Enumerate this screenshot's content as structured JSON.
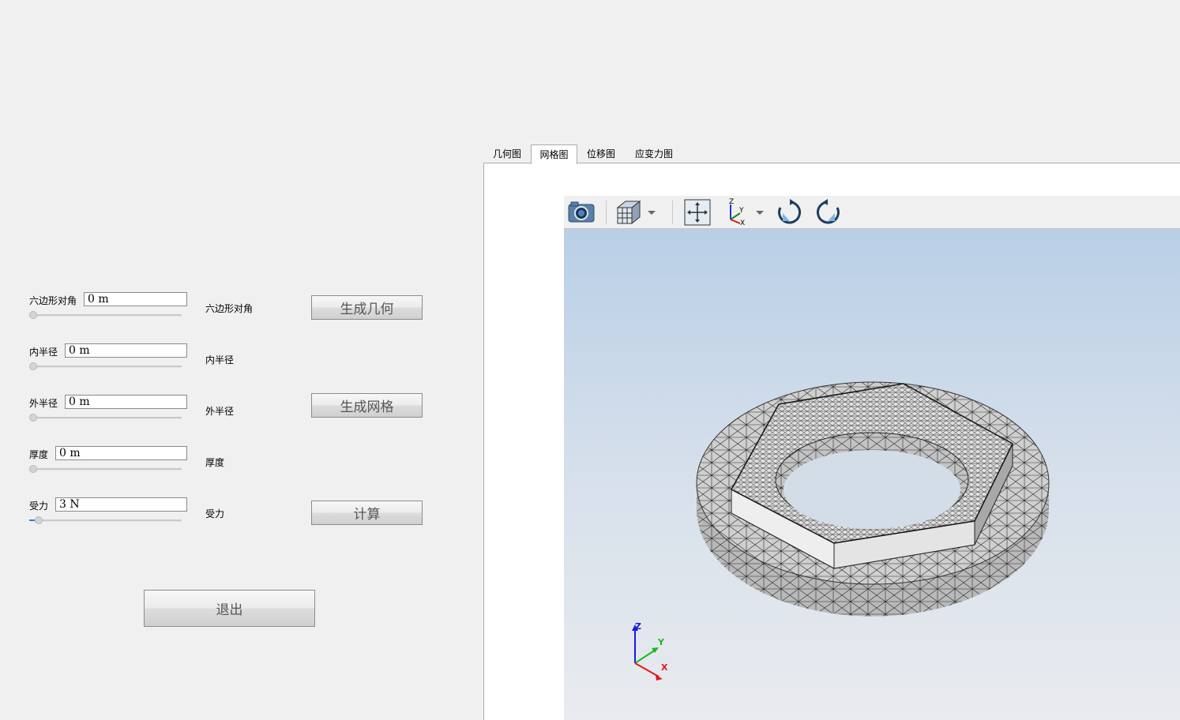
{
  "form": {
    "rows": [
      {
        "label": "六边形对角",
        "value": "0 m",
        "side_label": "六边形对角",
        "slider_pct": 0
      },
      {
        "label": "内半径",
        "value": "0 m",
        "side_label": "内半径",
        "slider_pct": 0
      },
      {
        "label": "外半径",
        "value": "0 m",
        "side_label": "外半径",
        "slider_pct": 0
      },
      {
        "label": "厚度",
        "value": "0 m",
        "side_label": "厚度",
        "slider_pct": 0
      },
      {
        "label": "受力",
        "value": "3 N",
        "side_label": "受力",
        "slider_pct": 4
      }
    ],
    "buttons": {
      "generate_geometry": "生成几何",
      "generate_mesh": "生成网格",
      "compute": "计算",
      "exit": "退出"
    }
  },
  "tabs": [
    {
      "label": "几何图",
      "active": false
    },
    {
      "label": "网格图",
      "active": true
    },
    {
      "label": "位移图",
      "active": false
    },
    {
      "label": "应变力图",
      "active": false
    }
  ],
  "toolbar": {
    "icons": [
      "camera-icon",
      "view-cube-icon",
      "dropdown-arrow-icon",
      "fit-view-icon",
      "axes-orientation-icon",
      "dropdown-arrow-icon",
      "rotate-cw-icon",
      "rotate-ccw-icon"
    ]
  },
  "viewport": {
    "model": "meshed hexagon nut with flange",
    "axes": {
      "x": "X",
      "y": "Y",
      "z": "Z"
    },
    "axis_colors": {
      "x": "#e02020",
      "y": "#20c020",
      "z": "#2020e0"
    }
  },
  "colors": {
    "window_bg": "#f0f0f0",
    "viewport_top": "#b9cfe6",
    "viewport_bottom": "#e9ebef",
    "mesh_face": "#c8c8c8",
    "mesh_line": "#202020"
  }
}
